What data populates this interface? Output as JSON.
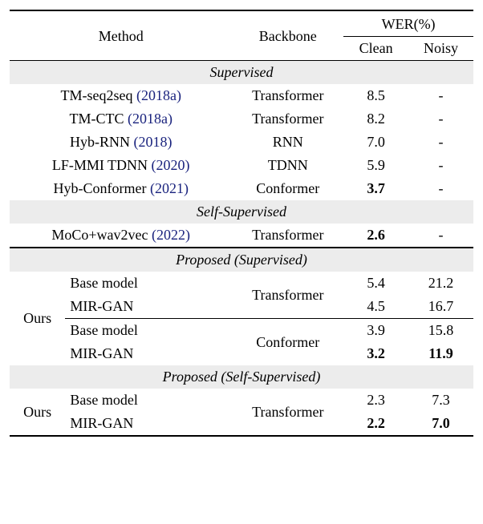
{
  "header": {
    "method": "Method",
    "backbone": "Backbone",
    "wer": "WER(%)",
    "clean": "Clean",
    "noisy": "Noisy"
  },
  "sections": {
    "supervised": "Supervised",
    "self_supervised": "Self-Supervised",
    "proposed_supervised": "Proposed (Supervised)",
    "proposed_self_supervised": "Proposed (Self-Supervised)"
  },
  "rows": {
    "tm_seq2seq": {
      "method": "TM-seq2seq ",
      "cite": "(2018a)",
      "backbone": "Transformer",
      "clean": "8.5",
      "noisy": "-"
    },
    "tm_ctc": {
      "method": "TM-CTC ",
      "cite": "(2018a)",
      "backbone": "Transformer",
      "clean": "8.2",
      "noisy": "-"
    },
    "hyb_rnn": {
      "method": "Hyb-RNN ",
      "cite": "(2018)",
      "backbone": "RNN",
      "clean": "7.0",
      "noisy": "-"
    },
    "lf_mmi": {
      "method": "LF-MMI TDNN ",
      "cite": "(2020)",
      "backbone": "TDNN",
      "clean": "5.9",
      "noisy": "-"
    },
    "hyb_conf": {
      "method": "Hyb-Conformer ",
      "cite": "(2021)",
      "backbone": "Conformer",
      "clean": "3.7",
      "noisy": "-"
    },
    "moco": {
      "method": "MoCo+wav2vec ",
      "cite": "(2022)",
      "backbone": "Transformer",
      "clean": "2.6",
      "noisy": "-"
    }
  },
  "proposed": {
    "ours": "Ours",
    "t1": {
      "model": "Base model",
      "backbone": "Transformer",
      "clean": "5.4",
      "noisy": "21.2"
    },
    "t2": {
      "model": "MIR-GAN",
      "clean": "4.5",
      "noisy": "16.7"
    },
    "c1": {
      "model": "Base model",
      "backbone": "Conformer",
      "clean": "3.9",
      "noisy": "15.8"
    },
    "c2": {
      "model": "MIR-GAN",
      "clean": "3.2",
      "noisy": "11.9"
    },
    "s1": {
      "model": "Base model",
      "backbone": "Transformer",
      "clean": "2.3",
      "noisy": "7.3"
    },
    "s2": {
      "model": "MIR-GAN",
      "clean": "2.2",
      "noisy": "7.0"
    }
  },
  "chart_data": {
    "type": "table",
    "title": "WER (%) comparison",
    "columns": [
      "Method",
      "Backbone",
      "WER Clean (%)",
      "WER Noisy (%)"
    ],
    "groups": [
      {
        "name": "Supervised",
        "rows": [
          [
            "TM-seq2seq (2018a)",
            "Transformer",
            8.5,
            null
          ],
          [
            "TM-CTC (2018a)",
            "Transformer",
            8.2,
            null
          ],
          [
            "Hyb-RNN (2018)",
            "RNN",
            7.0,
            null
          ],
          [
            "LF-MMI TDNN (2020)",
            "TDNN",
            5.9,
            null
          ],
          [
            "Hyb-Conformer (2021)",
            "Conformer",
            3.7,
            null
          ]
        ]
      },
      {
        "name": "Self-Supervised",
        "rows": [
          [
            "MoCo+wav2vec (2022)",
            "Transformer",
            2.6,
            null
          ]
        ]
      },
      {
        "name": "Proposed (Supervised)",
        "rows": [
          [
            "Ours Base model",
            "Transformer",
            5.4,
            21.2
          ],
          [
            "Ours MIR-GAN",
            "Transformer",
            4.5,
            16.7
          ],
          [
            "Ours Base model",
            "Conformer",
            3.9,
            15.8
          ],
          [
            "Ours MIR-GAN",
            "Conformer",
            3.2,
            11.9
          ]
        ]
      },
      {
        "name": "Proposed (Self-Supervised)",
        "rows": [
          [
            "Ours Base model",
            "Transformer",
            2.3,
            7.3
          ],
          [
            "Ours MIR-GAN",
            "Transformer",
            2.2,
            7.0
          ]
        ]
      }
    ]
  }
}
